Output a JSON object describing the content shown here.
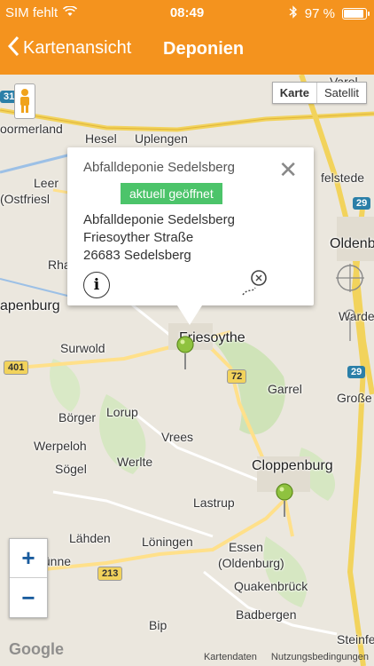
{
  "status": {
    "carrier": "SIM fehlt",
    "time": "08:49",
    "battery": "97 %",
    "battery_level": 0.97
  },
  "nav": {
    "back_label": "Kartenansicht",
    "title": "Deponien"
  },
  "map_type": {
    "map": "Karte",
    "satellite": "Satellit"
  },
  "popup": {
    "title": "Abfalldeponie Sedelsberg",
    "status_badge": "aktuell geöffnet",
    "address_line1": "Abfalldeponie Sedelsberg",
    "address_line2": "Friesoyther Straße",
    "address_line3": "26683 Sedelsberg"
  },
  "places": {
    "hesel": "Hesel",
    "uplengen": "Uplengen",
    "leer": "Leer",
    "ostfriesland": "(Ostfriesl",
    "ooermerland": "oormerland",
    "rha": "Rha",
    "papenburg": "apenburg",
    "surwold": "Surwold",
    "friesoythe": "Friesoythe",
    "garrel": "Garrel",
    "grosse": "Große",
    "oldenburg": "Oldenb",
    "boerger": "Börger",
    "lorup": "Lorup",
    "werpeloh": "Werpeloh",
    "voegel": "Sögel",
    "werlte": "Werlte",
    "vrees": "Vrees",
    "cloppenburg": "Cloppenburg",
    "lastrup": "Lastrup",
    "laehden": "Lähden",
    "loeningen": "Löningen",
    "essen": "Essen",
    "essen2": "(Oldenburg)",
    "quakenbrueck": "Quakenbrück",
    "badbergen": "Badbergen",
    "luenne": "elünne",
    "bippen": "Bip",
    "steinfeld": "Steinfe",
    "elsfleth": "felstede",
    "varel": "Varel",
    "wardenburg": "Wardenb"
  },
  "roads": {
    "r401": "401",
    "r72": "72",
    "r29a": "29",
    "r29b": "29",
    "r213": "213",
    "r31": "31"
  },
  "footer": {
    "google": "Google",
    "data": "Kartendaten",
    "terms": "Nutzungsbedingungen"
  }
}
